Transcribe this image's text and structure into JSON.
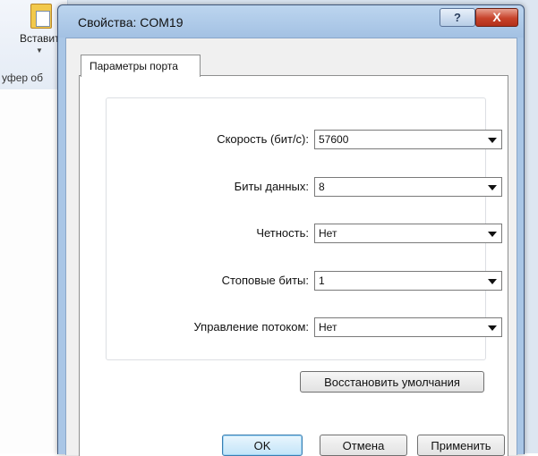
{
  "background_app": {
    "paste_label": "Вставит",
    "clipboard_label": "уфер об"
  },
  "window": {
    "title": "Свойства: COM19",
    "help_button_label": "?",
    "close_button_label": "X"
  },
  "tabs": [
    {
      "label": "Параметры порта",
      "selected": true
    }
  ],
  "settings": [
    {
      "label": "Скорость (бит/с):",
      "value": "57600"
    },
    {
      "label": "Биты данных:",
      "value": "8"
    },
    {
      "label": "Четность:",
      "value": "Нет"
    },
    {
      "label": "Стоповые биты:",
      "value": "1"
    },
    {
      "label": "Управление потоком:",
      "value": "Нет"
    }
  ],
  "buttons": {
    "restore_defaults": "Восстановить умолчания",
    "ok": "OK",
    "cancel": "Отмена",
    "apply": "Применить"
  }
}
